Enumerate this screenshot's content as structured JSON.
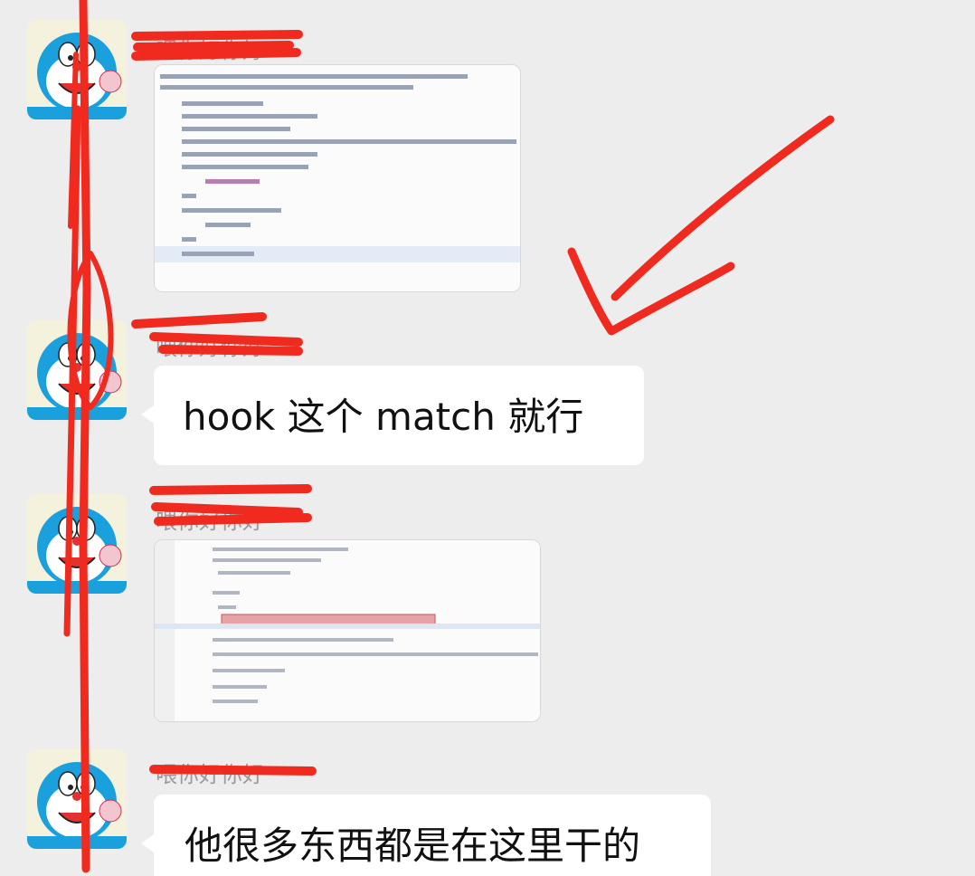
{
  "messages": [
    {
      "sender": "喂你好你好",
      "type": "image",
      "alt": "code screenshot"
    },
    {
      "sender": "喂你好你好",
      "type": "text",
      "text": "hook 这个 match 就行"
    },
    {
      "sender": "喂你好你好",
      "type": "image",
      "alt": "code screenshot"
    },
    {
      "sender": "喂你好你好",
      "type": "text",
      "text": "他很多东西都是在这里干的"
    }
  ],
  "colors": {
    "background": "#ededed",
    "bubble": "#ffffff",
    "annotation": "#f02a1e"
  },
  "annotations": [
    "red-strikethrough-lines",
    "red-checkmark"
  ]
}
